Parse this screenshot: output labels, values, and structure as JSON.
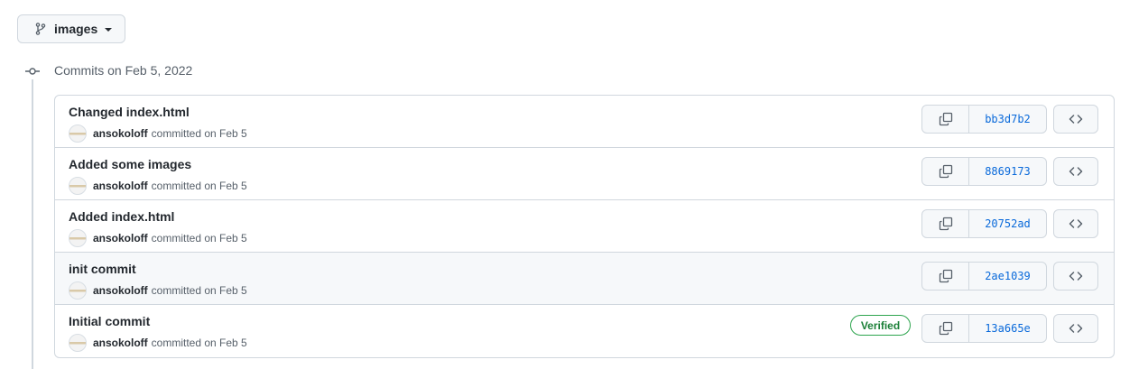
{
  "branch": {
    "name": "images",
    "icon": "git-branch-icon"
  },
  "timeline": {
    "heading": "Commits on Feb 5, 2022",
    "icon": "git-commit-icon"
  },
  "commits": [
    {
      "title": "Changed index.html",
      "author": "ansokoloff",
      "meta": "committed on Feb 5",
      "sha": "bb3d7b2",
      "verified": ""
    },
    {
      "title": "Added some images",
      "author": "ansokoloff",
      "meta": "committed on Feb 5",
      "sha": "8869173",
      "verified": ""
    },
    {
      "title": "Added index.html",
      "author": "ansokoloff",
      "meta": "committed on Feb 5",
      "sha": "20752ad",
      "verified": ""
    },
    {
      "title": "init commit",
      "author": "ansokoloff",
      "meta": "committed on Feb 5",
      "sha": "2ae1039",
      "verified": ""
    },
    {
      "title": "Initial commit",
      "author": "ansokoloff",
      "meta": "committed on Feb 5",
      "sha": "13a665e",
      "verified": "Verified"
    }
  ],
  "colors": {
    "link": "#0969da",
    "verified": "#1a7f37",
    "border": "#d0d7de"
  }
}
